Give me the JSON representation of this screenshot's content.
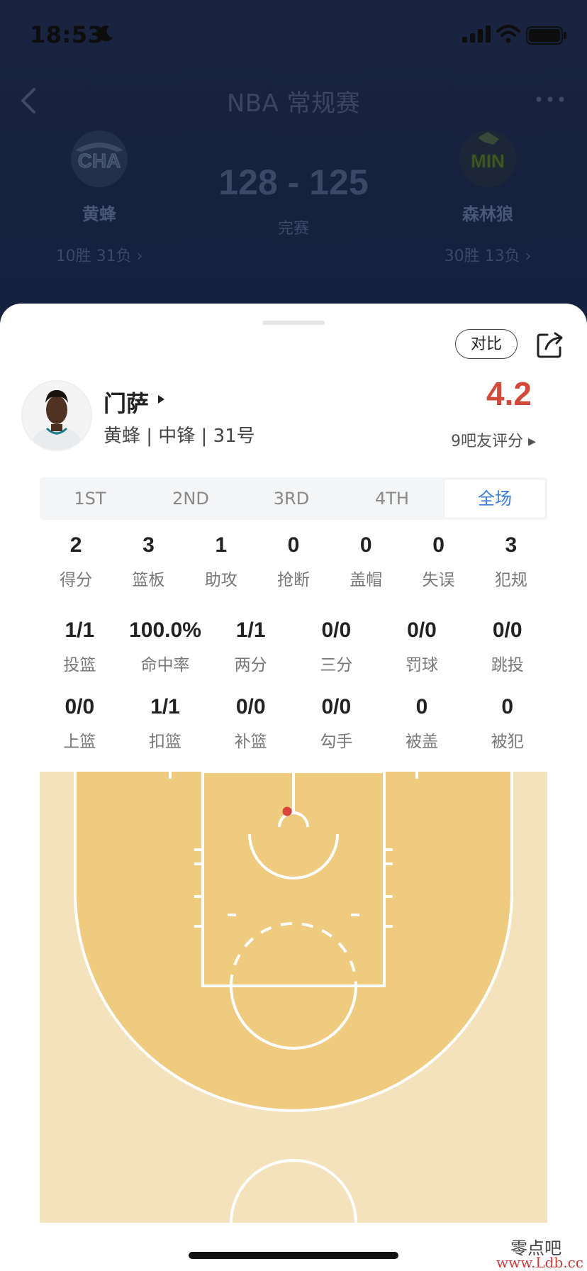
{
  "status_bar": {
    "time": "18:53"
  },
  "header": {
    "title": "NBA 常规赛",
    "home": {
      "abbr": "CHA",
      "name": "黄蜂",
      "record": "10胜 31负 ›",
      "color": "#1a7f8e"
    },
    "away": {
      "abbr": "MIN",
      "name": "森林狼",
      "record": "30胜 13负 ›",
      "color": "#7a9a2e"
    },
    "score": "128 - 125",
    "status": "完赛"
  },
  "player": {
    "compare_label": "对比",
    "name": "门萨",
    "meta": "黄蜂 | 中锋 | 31号",
    "rating": "4.2",
    "rating_label": "9吧友评分 ▸",
    "rating_color": "#d44a3a"
  },
  "period_tabs": [
    {
      "label": "1ST",
      "active": false
    },
    {
      "label": "2ND",
      "active": false
    },
    {
      "label": "3RD",
      "active": false
    },
    {
      "label": "4TH",
      "active": false
    },
    {
      "label": "全场",
      "active": true
    }
  ],
  "stats_main": [
    {
      "value": "2",
      "label": "得分"
    },
    {
      "value": "3",
      "label": "篮板"
    },
    {
      "value": "1",
      "label": "助攻"
    },
    {
      "value": "0",
      "label": "抢断"
    },
    {
      "value": "0",
      "label": "盖帽"
    },
    {
      "value": "0",
      "label": "失误"
    },
    {
      "value": "3",
      "label": "犯规"
    }
  ],
  "stats_shooting": [
    {
      "value": "1/1",
      "label": "投篮"
    },
    {
      "value": "100.0%",
      "label": "命中率"
    },
    {
      "value": "1/1",
      "label": "两分"
    },
    {
      "value": "0/0",
      "label": "三分"
    },
    {
      "value": "0/0",
      "label": "罚球"
    },
    {
      "value": "0/0",
      "label": "跳投"
    }
  ],
  "stats_detail": [
    {
      "value": "0/0",
      "label": "上篮"
    },
    {
      "value": "1/1",
      "label": "扣篮"
    },
    {
      "value": "0/0",
      "label": "补篮"
    },
    {
      "value": "0/0",
      "label": "勾手"
    },
    {
      "value": "0",
      "label": "被盖"
    },
    {
      "value": "0",
      "label": "被犯"
    }
  ],
  "court": {
    "outer_color": "#f4e2bd",
    "inner_color": "#eecb7f",
    "shot_color": "#d9453a"
  },
  "watermark": {
    "text": "零点吧",
    "url": "www.Ldb.cc"
  }
}
